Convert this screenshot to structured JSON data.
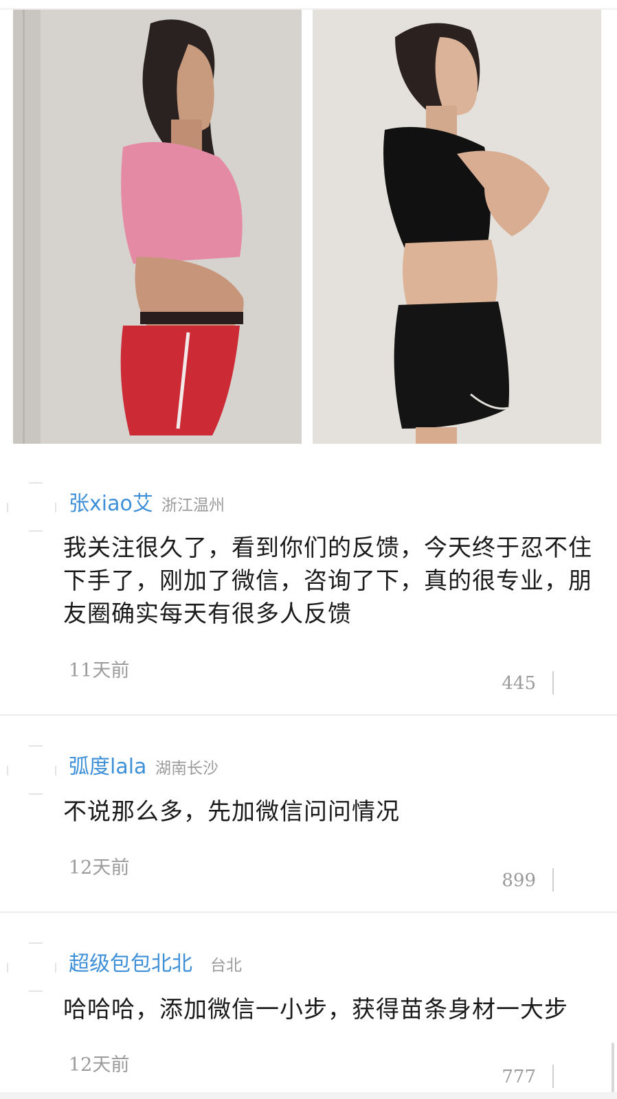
{
  "comments": [
    {
      "username": "张xiao艾",
      "location": "浙江温州",
      "text": "我关注很久了，看到你们的反馈，今天终于忍不住下手了，刚加了微信，咨询了下，真的很专业，朋友圈确实每天有很多人反馈",
      "time": "11天前",
      "likes": "445"
    },
    {
      "username": "弧度lala",
      "location": "湖南长沙",
      "text": "不说那么多，先加微信问问情况",
      "time": "12天前",
      "likes": "899"
    },
    {
      "username": "超级包包北北",
      "location": "台北",
      "text": "哈哈哈，添加微信一小步，获得苗条身材一大步",
      "time": "12天前",
      "likes": "777"
    }
  ],
  "colors": {
    "username": "#3d8fd8",
    "meta": "#9a9a9a",
    "text": "#1a1a1a"
  }
}
